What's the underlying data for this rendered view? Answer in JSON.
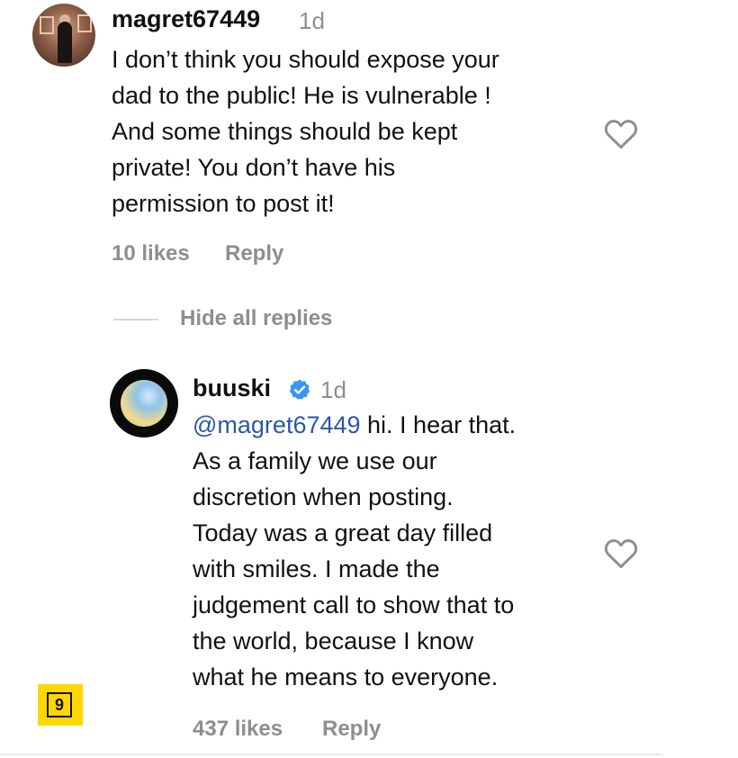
{
  "comment1": {
    "username": "magret67449",
    "time": "1d",
    "lines": [
      "I don’t think you should expose your",
      "dad to the public! He is vulnerable !",
      "And some things should be kept",
      "private! You don’t have his",
      "permission to post it!"
    ],
    "likes": "10 likes",
    "reply_label": "Reply"
  },
  "replies_toggle": "Hide all replies",
  "reply1": {
    "username": "buuski",
    "time": "1d",
    "mention": "@magret67449",
    "line1_rest": " hi. I hear that.",
    "lines": [
      "As a family we use our",
      "discretion when posting.",
      "Today was a great day filled",
      "with smiles. I made the",
      "judgement call to show that to",
      "the world, because I know",
      "what he means to everyone."
    ],
    "likes": "437 likes",
    "reply_label": "Reply"
  },
  "badge": {
    "number": "9",
    "color": "#ffd700"
  },
  "colors": {
    "mention": "#2b57a7",
    "meta": "#8e8e8e",
    "verified": "#3897f0"
  }
}
